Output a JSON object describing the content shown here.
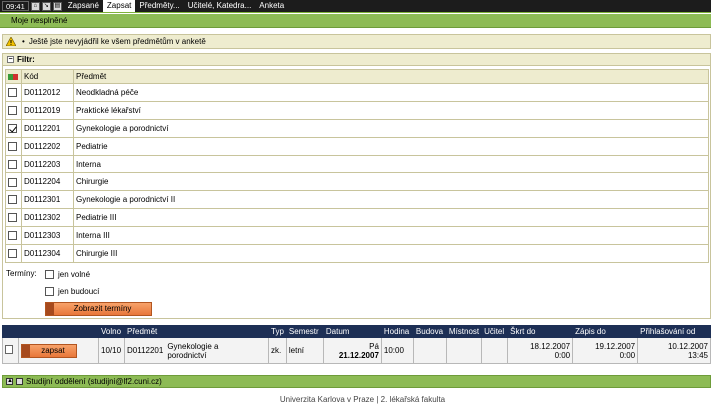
{
  "nav": {
    "clock": "09:41",
    "items": [
      "Zapsané",
      "Zapsat",
      "Předměty...",
      "Učitelé, Katedra...",
      "Anketa"
    ],
    "active_index": 1,
    "subtab": "Moje nesplněné"
  },
  "info": {
    "message": "Ještě jste nevyjádřil ke všem předmětům v anketě"
  },
  "filter": {
    "title": "Filtr:",
    "headers": {
      "code": "Kód",
      "subject": "Předmět"
    },
    "rows": [
      {
        "code": "D0112012",
        "name": "Neodkladná péče",
        "checked": false
      },
      {
        "code": "D0112019",
        "name": "Praktické lékařství",
        "checked": false
      },
      {
        "code": "D0112201",
        "name": "Gynekologie a porodnictví",
        "checked": true
      },
      {
        "code": "D0112202",
        "name": "Pediatrie",
        "checked": false
      },
      {
        "code": "D0112203",
        "name": "Interna",
        "checked": false
      },
      {
        "code": "D0112204",
        "name": "Chirurgie",
        "checked": false
      },
      {
        "code": "D0112301",
        "name": "Gynekologie a porodnictví II",
        "checked": false
      },
      {
        "code": "D0112302",
        "name": "Pediatrie III",
        "checked": false
      },
      {
        "code": "D0112303",
        "name": "Interna III",
        "checked": false
      },
      {
        "code": "D0112304",
        "name": "Chirurgie III",
        "checked": false
      }
    ],
    "terms_label": "Termíny:",
    "opt_free": "jen volné",
    "opt_future": "jen budoucí",
    "show_button": "Zobrazit termíny"
  },
  "results": {
    "headers": [
      "",
      "",
      "Volno",
      "Předmět",
      "Typ",
      "Semestr",
      "Datum",
      "Hodina",
      "Budova",
      "Místnost",
      "Učitel",
      "Škrt do",
      "Zápis do",
      "Přihlašování od"
    ],
    "row": {
      "button": "zapsat",
      "volno": "10/10",
      "code": "D0112201",
      "name": "Gynekologie a porodnictví",
      "typ": "zk.",
      "semestr": "letní",
      "day": "Pá",
      "date": "21.12.2007",
      "hodina": "10:00",
      "budova": "",
      "mistnost": "",
      "ucitel": "",
      "skrt_date": "18.12.2007",
      "skrt_time": "0:00",
      "zapis_date": "19.12.2007",
      "zapis_time": "0:00",
      "prihl_date": "10.12.2007",
      "prihl_time": "13:45"
    }
  },
  "footbar": {
    "text": "Studijní oddělení (studijni@lf2.cuni.cz)"
  },
  "footer": {
    "text": "Univerzita Karlova v Praze | 2. lékařská fakulta"
  },
  "colors": {
    "green": "#8dbb55",
    "navy": "#1d2f55",
    "beige": "#eeeccf",
    "orange": "#e8773a"
  }
}
